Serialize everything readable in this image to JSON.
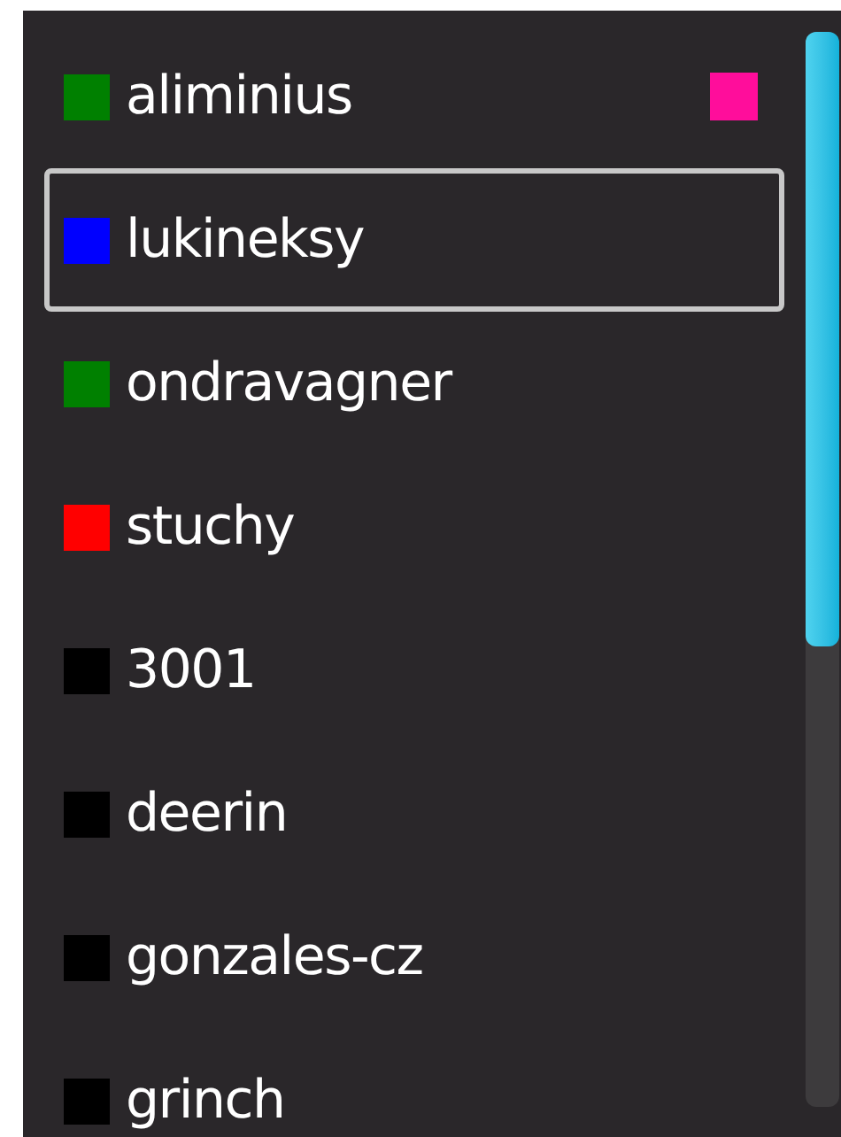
{
  "list": {
    "items": [
      {
        "name": "aliminius",
        "color": "#008000",
        "selected": false,
        "flag": {
          "color": "#ff0d9b"
        }
      },
      {
        "name": "lukineksy",
        "color": "#0000ff",
        "selected": true
      },
      {
        "name": "ondravagner",
        "color": "#008000",
        "selected": false
      },
      {
        "name": "stuchy",
        "color": "#ff0000",
        "selected": false
      },
      {
        "name": "3001",
        "color": "#000000",
        "selected": false
      },
      {
        "name": "deerin",
        "color": "#000000",
        "selected": false
      },
      {
        "name": "gonzales-cz",
        "color": "#000000",
        "selected": false
      },
      {
        "name": "grinch",
        "color": "#000000",
        "selected": false
      }
    ]
  }
}
